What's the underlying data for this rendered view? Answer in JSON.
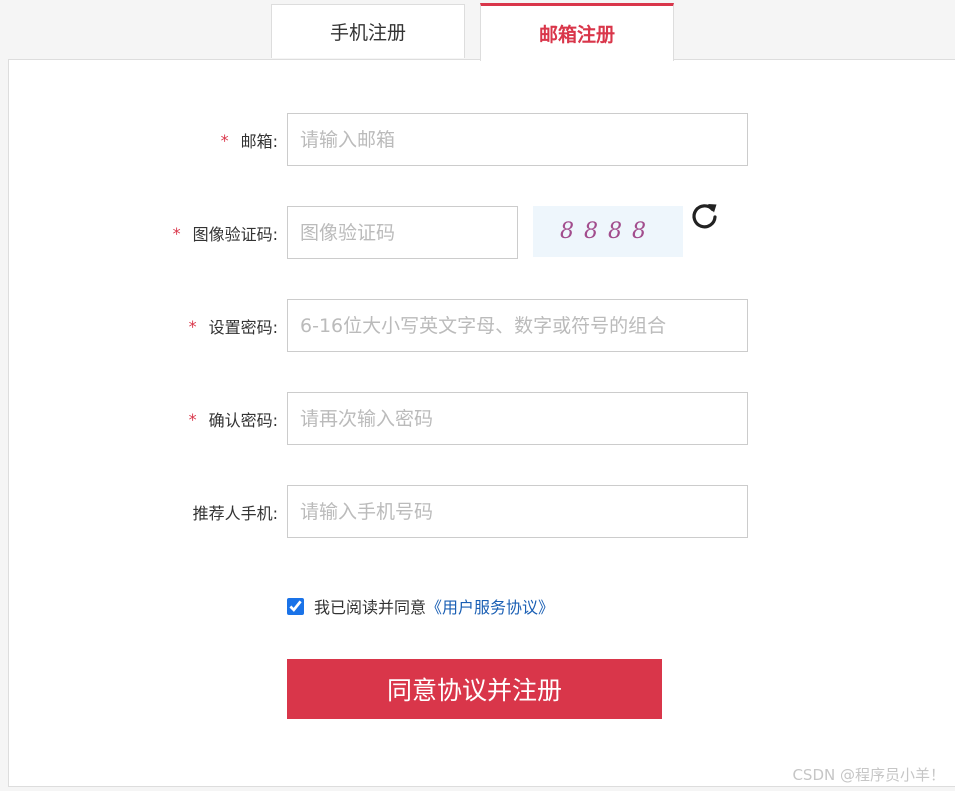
{
  "tabs": [
    {
      "label": "手机注册",
      "active": false
    },
    {
      "label": "邮箱注册",
      "active": true
    }
  ],
  "form": {
    "email": {
      "required_mark": "*",
      "label": "邮箱:",
      "placeholder": "请输入邮箱",
      "value": ""
    },
    "captcha": {
      "required_mark": "*",
      "label": "图像验证码:",
      "placeholder": "图像验证码",
      "value": "",
      "image_text": "8888",
      "refresh_icon": "refresh-icon"
    },
    "password": {
      "required_mark": "*",
      "label": "设置密码:",
      "placeholder": "6-16位大小写英文字母、数字或符号的组合",
      "value": ""
    },
    "confirm_password": {
      "required_mark": "*",
      "label": "确认密码:",
      "placeholder": "请再次输入密码",
      "value": ""
    },
    "referrer": {
      "label": "推荐人手机:",
      "placeholder": "请输入手机号码",
      "value": ""
    }
  },
  "agreement": {
    "checked": true,
    "text": "我已阅读并同意",
    "link": "《用户服务协议》"
  },
  "submit_label": "同意协议并注册",
  "watermark": "CSDN @程序员小羊！",
  "colors": {
    "accent": "#d9364a",
    "link": "#1a5fb4",
    "captcha_text": "#a24d8d"
  }
}
